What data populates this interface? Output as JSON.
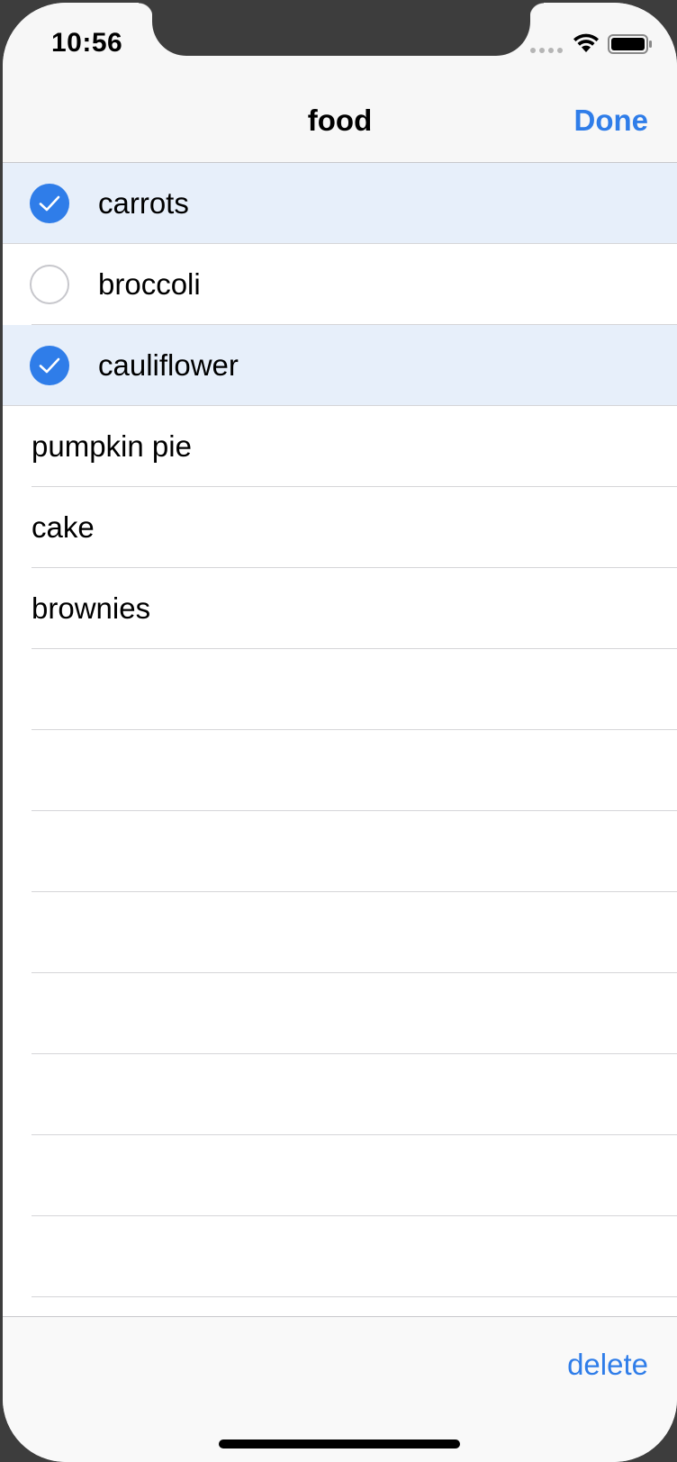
{
  "status_bar": {
    "time": "10:56",
    "wifi_icon": "wifi-icon",
    "battery_icon": "battery-full-icon"
  },
  "nav_bar": {
    "title": "food",
    "done_label": "Done"
  },
  "list": {
    "items": [
      {
        "label": "carrots",
        "editable": true,
        "selected": true
      },
      {
        "label": "broccoli",
        "editable": true,
        "selected": false
      },
      {
        "label": "cauliflower",
        "editable": true,
        "selected": true
      },
      {
        "label": "pumpkin pie",
        "editable": false,
        "selected": false
      },
      {
        "label": "cake",
        "editable": false,
        "selected": false
      },
      {
        "label": "brownies",
        "editable": false,
        "selected": false
      }
    ]
  },
  "toolbar": {
    "delete_label": "delete"
  },
  "colors": {
    "accent": "#2f7de9",
    "selected_row": "#e7effa",
    "bezel": "#3d3d3d"
  }
}
